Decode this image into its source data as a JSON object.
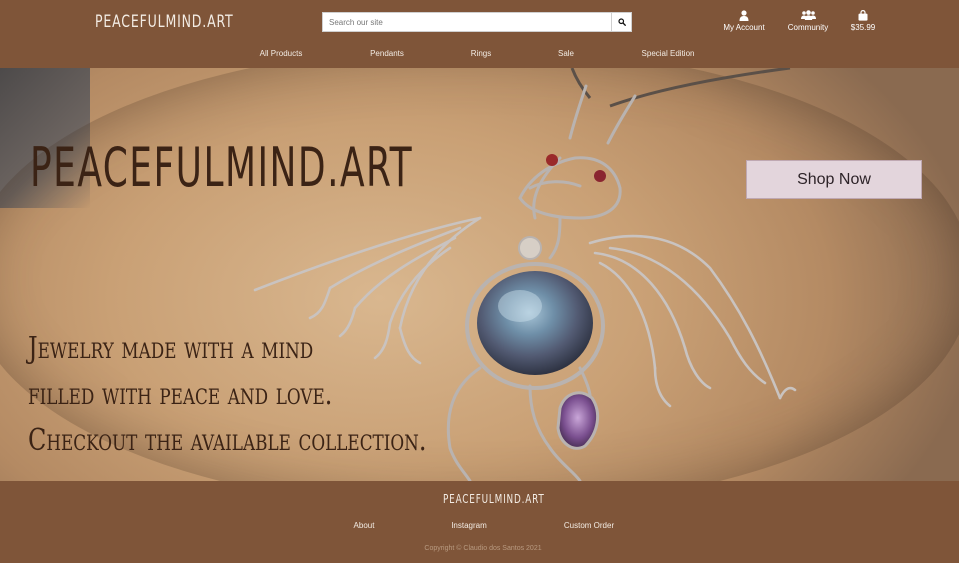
{
  "header": {
    "brand": "PEACEFULMIND.ART",
    "search": {
      "placeholder": "Search our site",
      "value": ""
    },
    "utility": {
      "account_label": "My Account",
      "community_label": "Community",
      "bag_total": "$35.99"
    },
    "nav": [
      "All Products",
      "Pendants",
      "Rings",
      "Sale",
      "Special Edition"
    ]
  },
  "hero": {
    "title": "PEACEFULMIND.ART",
    "tagline": [
      "Jewelry made with a mind",
      "filled with peace and love.",
      "Checkout the available collection."
    ],
    "cta_label": "Shop Now"
  },
  "footer": {
    "brand": "PEACEFULMIND.ART",
    "links": [
      "About",
      "Instagram",
      "Custom Order"
    ],
    "copyright": "Copyright © Claudio dos Santos 2021"
  },
  "colors": {
    "header_bg": "#7f5539",
    "hero_text": "#3b2315",
    "cta_bg": "#e3d5dc"
  },
  "icons": {
    "search": "search-icon",
    "account": "user-icon",
    "community": "users-icon",
    "bag": "shopping-bag-icon"
  }
}
